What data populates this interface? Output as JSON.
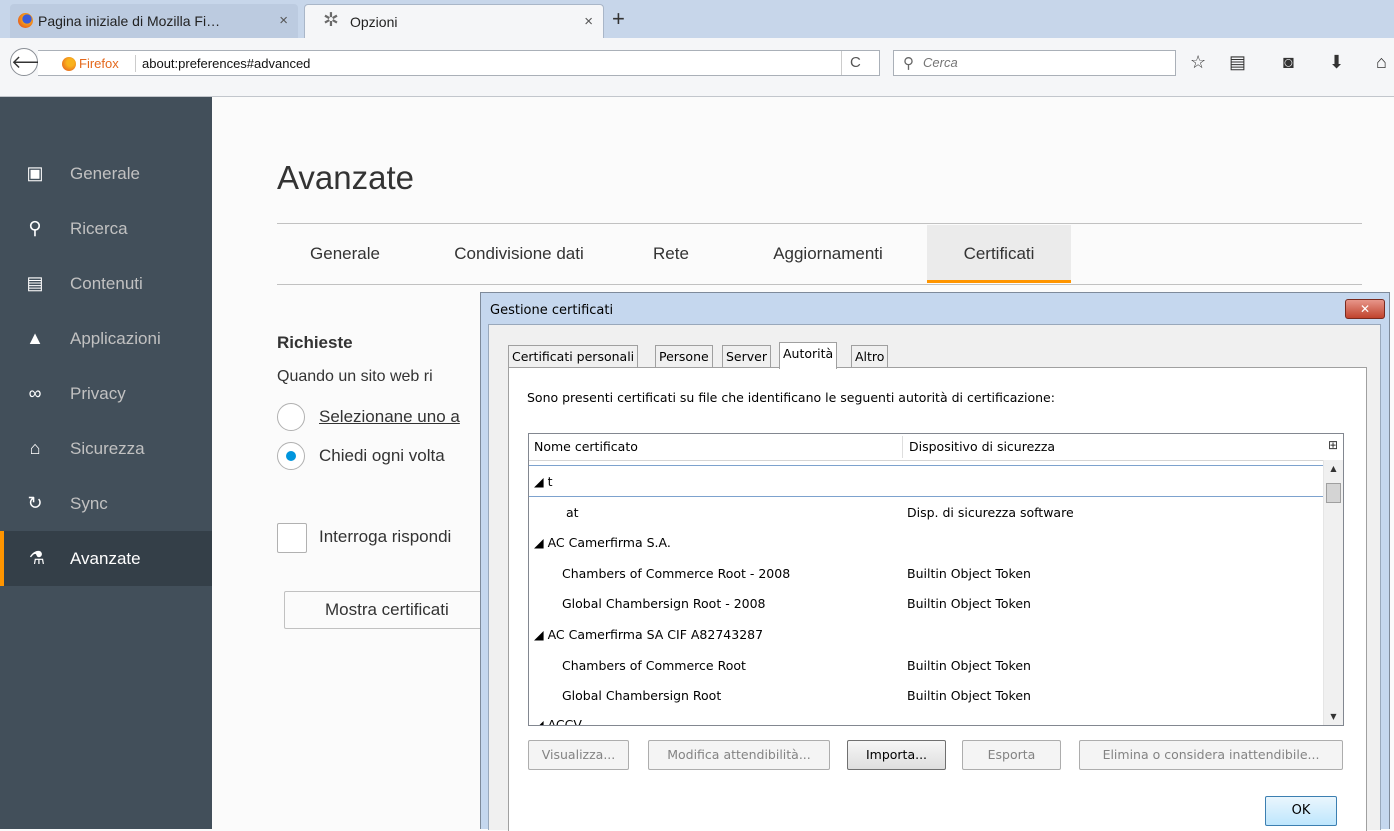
{
  "browser": {
    "tabs": [
      {
        "label": "Pagina iniziale di Mozilla Fi…",
        "close": "×"
      },
      {
        "label": "Opzioni",
        "close": "×"
      }
    ],
    "new_tab": "+",
    "back": "🡐",
    "identity_label": "Firefox",
    "url": "about:preferences#advanced",
    "reload": "C",
    "search_placeholder": "Cerca",
    "toolbar_icons": [
      "star-icon",
      "reading-list-icon",
      "pocket-icon",
      "download-icon",
      "home-icon"
    ]
  },
  "sidebar": {
    "items": [
      {
        "label": "Generale",
        "icon": "general-icon"
      },
      {
        "label": "Ricerca",
        "icon": "search-icon"
      },
      {
        "label": "Contenuti",
        "icon": "content-icon"
      },
      {
        "label": "Applicazioni",
        "icon": "applications-icon"
      },
      {
        "label": "Privacy",
        "icon": "privacy-mask-icon"
      },
      {
        "label": "Sicurezza",
        "icon": "security-icon"
      },
      {
        "label": "Sync",
        "icon": "sync-icon"
      },
      {
        "label": "Avanzate",
        "icon": "advanced-icon",
        "selected": true
      }
    ],
    "accent": "#ff9500"
  },
  "main": {
    "title": "Avanzate",
    "subtabs": [
      "Generale",
      "Condivisione dati",
      "Rete",
      "Aggiornamenti",
      "Certificati"
    ],
    "selected_subtab": "Certificati",
    "section_title": "Richieste",
    "section_desc": "Quando un sito web ri",
    "radio1": "Selezionane uno a",
    "radio2": "Chiedi ogni volta",
    "checkbox": "Interroga rispondi",
    "show_button": "Mostra certificati"
  },
  "dialog": {
    "title": "Gestione certificati",
    "close": "✕",
    "tabs": [
      "Certificati personali",
      "Persone",
      "Server",
      "Autorità",
      "Altro"
    ],
    "selected_tab": "Autorità",
    "description": "Sono presenti certificati su file che identificano le seguenti autorità di certificazione:",
    "columns": [
      "Nome certificato",
      "Dispositivo di sicurezza"
    ],
    "rows": [
      {
        "name": "◢ t",
        "device": "",
        "group": true
      },
      {
        "name": "at",
        "device": "Disp. di sicurezza software",
        "group": false
      },
      {
        "name": "◢ AC Camerfirma S.A.",
        "device": "",
        "group": true
      },
      {
        "name": "Chambers of Commerce Root - 2008",
        "device": "Builtin Object Token",
        "group": false
      },
      {
        "name": "Global Chambersign Root - 2008",
        "device": "Builtin Object Token",
        "group": false
      },
      {
        "name": "◢ AC Camerfirma SA CIF A82743287",
        "device": "",
        "group": true
      },
      {
        "name": "Chambers of Commerce Root",
        "device": "Builtin Object Token",
        "group": false
      },
      {
        "name": "Global Chambersign Root",
        "device": "Builtin Object Token",
        "group": false
      },
      {
        "name": "◢ ACCV",
        "device": "",
        "group": true
      }
    ],
    "buttons": [
      {
        "label": "Visualizza...",
        "enabled": false
      },
      {
        "label": "Modifica attendibilità...",
        "enabled": false
      },
      {
        "label": "Importa...",
        "enabled": true
      },
      {
        "label": "Esporta",
        "enabled": false
      },
      {
        "label": "Elimina o considera inattendibile...",
        "enabled": false
      }
    ],
    "ok": "OK"
  }
}
